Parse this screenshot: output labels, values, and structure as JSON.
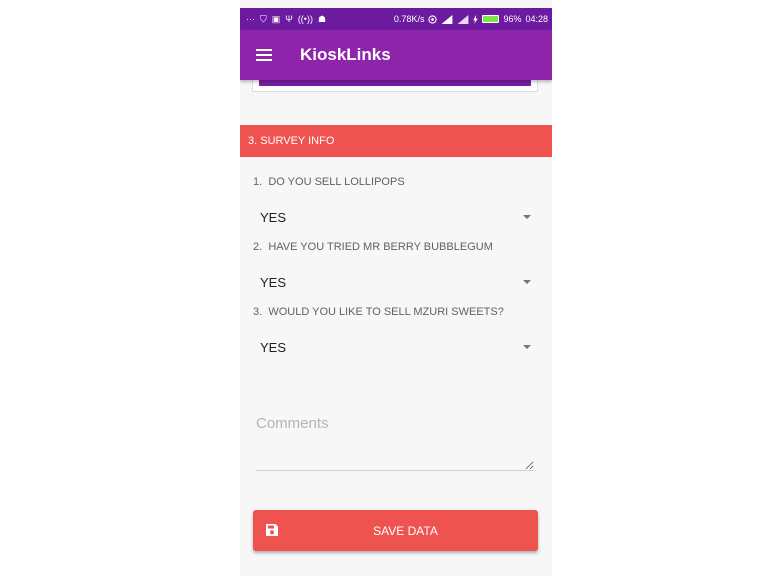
{
  "status_bar": {
    "left_icons": [
      "more-dots-icon",
      "shield-icon",
      "image-icon",
      "usb-icon",
      "hotspot-icon",
      "android-icon"
    ],
    "left_glyphs": [
      "···",
      "⛉",
      "▣",
      "Ψ",
      "((•))",
      "☗"
    ],
    "network_speed": "0.78K/s",
    "battery_level": "96%",
    "time": "04:28"
  },
  "app_bar": {
    "title": "KioskLinks"
  },
  "section": {
    "title": "3. SURVEY INFO"
  },
  "questions": [
    {
      "number": "1.",
      "text": "DO YOU SELL LOLLIPOPS",
      "answer": "YES"
    },
    {
      "number": "2.",
      "text": "HAVE YOU TRIED MR BERRY BUBBLEGUM",
      "answer": "YES"
    },
    {
      "number": "3.",
      "text": "WOULD YOU LIKE TO SELL MZURI SWEETS?",
      "answer": "YES"
    }
  ],
  "comments": {
    "placeholder": "Comments",
    "value": ""
  },
  "save_button": {
    "label": "SAVE DATA"
  },
  "colors": {
    "status_bar": "#6c1aa0",
    "app_bar": "#8e24aa",
    "section_header": "#ef5350",
    "save_button": "#ef5350",
    "battery_fill": "#7ee24a"
  }
}
